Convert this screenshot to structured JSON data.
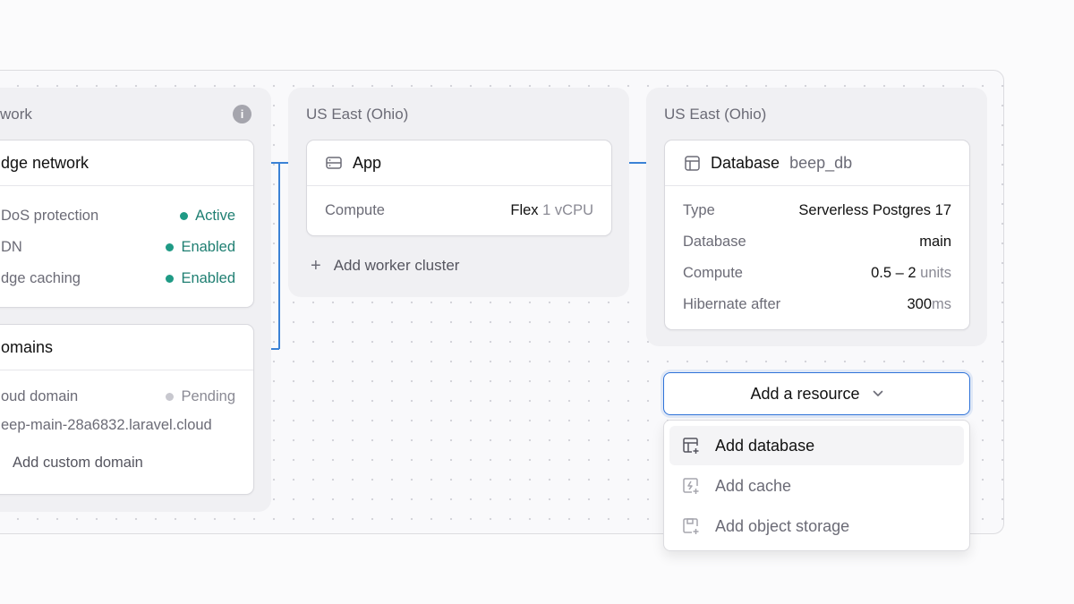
{
  "left_region": {
    "title": "work",
    "edge_card": {
      "title": "dge network",
      "rows": [
        {
          "label": "DoS protection",
          "status": "Active"
        },
        {
          "label": "DN",
          "status": "Enabled"
        },
        {
          "label": "dge caching",
          "status": "Enabled"
        }
      ]
    },
    "domains_card": {
      "title": "omains",
      "cloud_label": "oud domain",
      "cloud_status": "Pending",
      "domain_value": "eep-main-28a6832.laravel.cloud",
      "add_custom": "Add custom domain"
    }
  },
  "app_region": {
    "title": "US East (Ohio)",
    "card_title": "App",
    "compute_label": "Compute",
    "compute_value": "Flex",
    "compute_unit": "1 vCPU",
    "add_worker": "Add worker cluster"
  },
  "db_region": {
    "title": "US East (Ohio)",
    "card_title": "Database",
    "card_sub": "beep_db",
    "rows": [
      {
        "label": "Type",
        "value": "Serverless Postgres 17",
        "unit": ""
      },
      {
        "label": "Database",
        "value": "main",
        "unit": ""
      },
      {
        "label": "Compute",
        "value": "0.5 – 2",
        "unit": "units"
      },
      {
        "label": "Hibernate after",
        "value": "300",
        "unit": "ms"
      }
    ]
  },
  "add_resource": {
    "label": "Add a resource",
    "menu": [
      {
        "label": "Add database",
        "icon": "database-plus-icon"
      },
      {
        "label": "Add cache",
        "icon": "cache-plus-icon"
      },
      {
        "label": "Add object storage",
        "icon": "storage-plus-icon"
      }
    ]
  },
  "colors": {
    "accent": "#2f73d9",
    "success": "#1f9a85",
    "connector": "#3b82d6"
  }
}
